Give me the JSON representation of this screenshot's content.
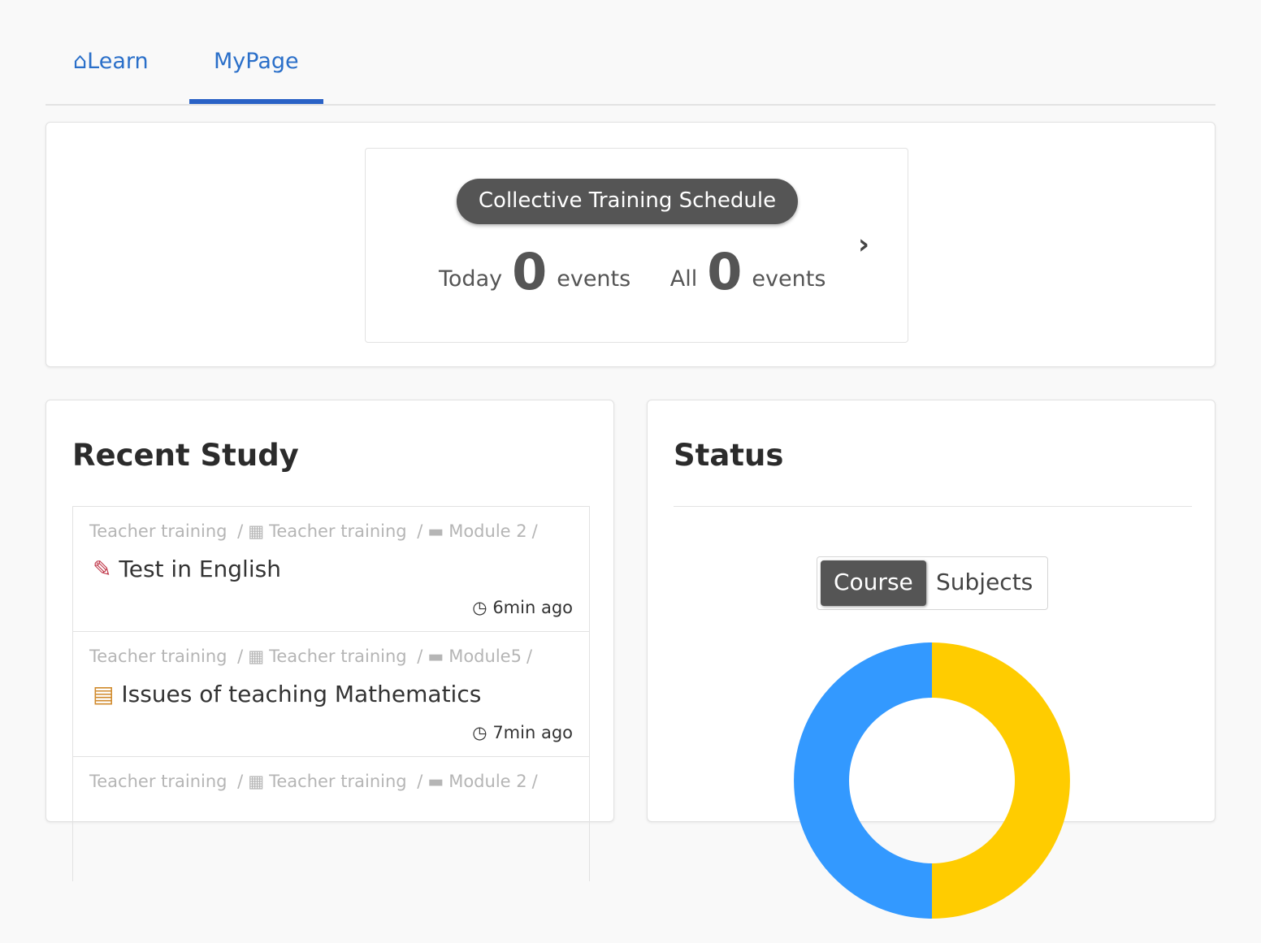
{
  "nav": {
    "tabs": [
      {
        "label": "Learn",
        "icon": "home-icon"
      },
      {
        "label": "MyPage",
        "active": true
      }
    ]
  },
  "schedule": {
    "title": "Collective Training Schedule",
    "today_label": "Today",
    "today_count": "0",
    "events_label": "events",
    "all_label": "All",
    "all_count": "0"
  },
  "recent": {
    "title": "Recent Study",
    "items": [
      {
        "crumbs": [
          "Teacher training",
          "Teacher training",
          "Module 2"
        ],
        "title": "Test in English",
        "icon": "pencil-icon",
        "time": "6min ago"
      },
      {
        "crumbs": [
          "Teacher training",
          "Teacher training",
          "Module5"
        ],
        "title": "Issues of teaching Mathematics",
        "icon": "document-icon",
        "time": "7min ago"
      },
      {
        "crumbs": [
          "Teacher training",
          "Teacher training",
          "Module 2"
        ],
        "title": "",
        "icon": "",
        "time": ""
      }
    ]
  },
  "status": {
    "title": "Status",
    "toggle": {
      "course": "Course",
      "subjects": "Subjects",
      "selected": "Course"
    }
  },
  "chart_data": {
    "type": "pie",
    "donut": true,
    "values": [
      50,
      50
    ],
    "colors": [
      "#ffcc00",
      "#3399ff"
    ]
  }
}
